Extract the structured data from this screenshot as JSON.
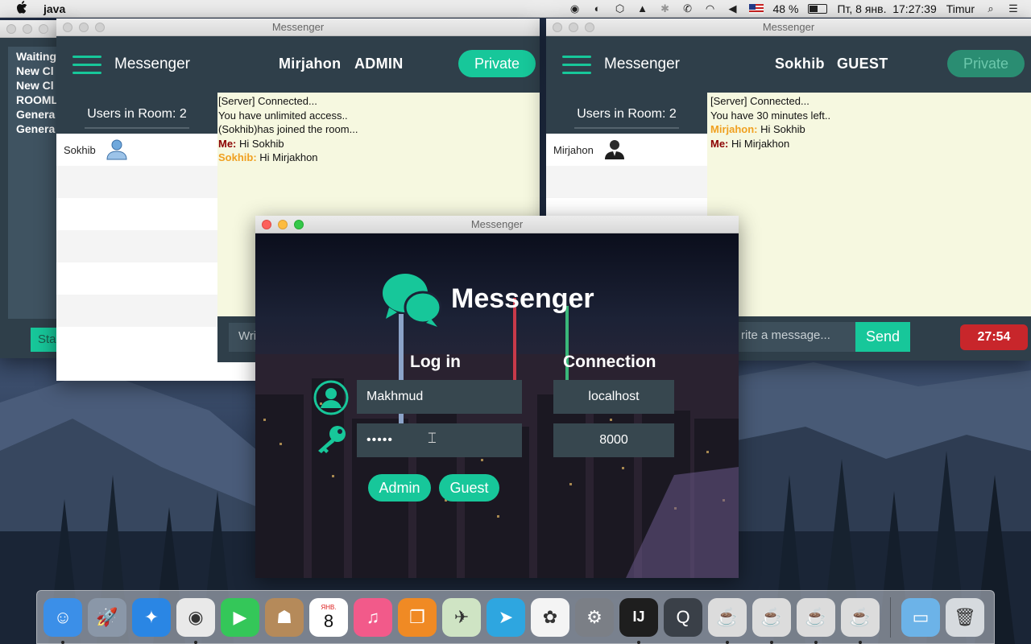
{
  "menubar": {
    "app_name": "java",
    "battery": "48 %",
    "datetime": "Пт, 8 янв.  17:27:39",
    "user": "Timur",
    "icons": [
      "record-icon",
      "headset-icon",
      "box-icon",
      "elephant-icon",
      "bluetooth-icon",
      "phone-icon",
      "wifi-icon",
      "volume-icon",
      "flag-icon",
      "battery-icon",
      "search-icon",
      "list-icon"
    ]
  },
  "back_window": {
    "items": [
      "Waiting",
      "New Cl",
      "New Cl",
      "ROOML",
      "Genera",
      "Genera"
    ],
    "button": "Sta"
  },
  "admin_window": {
    "title": "Messenger",
    "app_title": "Messenger",
    "user_name": "Mirjahon",
    "role": "ADMIN",
    "private_label": "Private",
    "room_label": "Users in Room: 2",
    "users": [
      {
        "name": "Sokhib",
        "icon": "user-blue-icon"
      }
    ],
    "messages": [
      {
        "sender": "",
        "text": "[Server] Connected..."
      },
      {
        "sender": "",
        "text": "You have unlimited access.."
      },
      {
        "sender": "",
        "text": "(Sokhib)has joined the room..."
      },
      {
        "sender": "Me:",
        "kind": "me",
        "text": " Hi Sokhib"
      },
      {
        "sender": "Sokhib:",
        "kind": "other",
        "text": " Hi Mirjakhon"
      }
    ],
    "input_placeholder": "Wri"
  },
  "guest_window": {
    "title": "Messenger",
    "app_title": "Messenger",
    "user_name": "Sokhib",
    "role": "GUEST",
    "private_label": "Private",
    "room_label": "Users in Room: 2",
    "users": [
      {
        "name": "Mirjahon",
        "icon": "user-dark-icon"
      }
    ],
    "messages": [
      {
        "sender": "",
        "text": "[Server] Connected..."
      },
      {
        "sender": "",
        "text": "You have 30 minutes left.."
      },
      {
        "sender": "Mirjahon:",
        "kind": "other",
        "text": " Hi Sokhib"
      },
      {
        "sender": "Me:",
        "kind": "me",
        "text": " Hi Mirjakhon"
      }
    ],
    "input_placeholder": "rite a message...",
    "send_label": "Send",
    "timer": "27:54"
  },
  "login_window": {
    "title": "Messenger",
    "logo_text": "Messenger",
    "login_title": "Log in",
    "connection_title": "Connection",
    "username": "Makhmud",
    "password": "•••••",
    "host": "localhost",
    "port": "8000",
    "admin_label": "Admin",
    "guest_label": "Guest"
  },
  "dock": {
    "calendar_month": "ЯНВ.",
    "calendar_day": "8",
    "items": [
      {
        "name": "finder-icon",
        "color": "#3b8fe8",
        "glyph": "☺",
        "running": true
      },
      {
        "name": "launchpad-icon",
        "color": "#8a97a8",
        "glyph": "🚀",
        "running": false
      },
      {
        "name": "safari-icon",
        "color": "#2a86e4",
        "glyph": "✦",
        "running": false
      },
      {
        "name": "chrome-icon",
        "color": "#e9e9e9",
        "glyph": "◉",
        "running": true
      },
      {
        "name": "facetime-icon",
        "color": "#34c759",
        "glyph": "▶",
        "running": false
      },
      {
        "name": "contacts-icon",
        "color": "#b58a5a",
        "glyph": "☗",
        "running": false
      },
      {
        "name": "calendar-icon",
        "color": "#ffffff",
        "glyph": "",
        "running": false
      },
      {
        "name": "itunes-icon",
        "color": "#f25a8a",
        "glyph": "♫",
        "running": false
      },
      {
        "name": "ibooks-icon",
        "color": "#f08a24",
        "glyph": "❐",
        "running": false
      },
      {
        "name": "maps-icon",
        "color": "#cfe4c4",
        "glyph": "✈",
        "running": false
      },
      {
        "name": "telegram-icon",
        "color": "#2ea6e0",
        "glyph": "➤",
        "running": false
      },
      {
        "name": "photos-icon",
        "color": "#f4f4f4",
        "glyph": "✿",
        "running": false
      },
      {
        "name": "system-preferences-icon",
        "color": "#7b7f86",
        "glyph": "⚙",
        "running": false
      },
      {
        "name": "intellij-icon",
        "color": "#1e1e1e",
        "glyph": "IJ",
        "running": true
      },
      {
        "name": "quicktime-icon",
        "color": "#3a4048",
        "glyph": "Q",
        "running": false
      },
      {
        "name": "java-icon-1",
        "color": "#dcdcdc",
        "glyph": "☕",
        "running": true
      },
      {
        "name": "java-icon-2",
        "color": "#dcdcdc",
        "glyph": "☕",
        "running": true
      },
      {
        "name": "java-icon-3",
        "color": "#dcdcdc",
        "glyph": "☕",
        "running": true
      },
      {
        "name": "java-icon-4",
        "color": "#dcdcdc",
        "glyph": "☕",
        "running": true
      }
    ],
    "trail": [
      {
        "name": "downloads-folder-icon",
        "color": "#6cb3e8",
        "glyph": "▭"
      },
      {
        "name": "trash-icon",
        "color": "#d6dade",
        "glyph": "🗑"
      }
    ]
  },
  "colors": {
    "accent": "#17c79a",
    "header": "#2f3f4a",
    "chat_bg": "#f6f8e0",
    "me": "#8b0000",
    "other": "#f0a020",
    "timer": "#c8262b"
  }
}
